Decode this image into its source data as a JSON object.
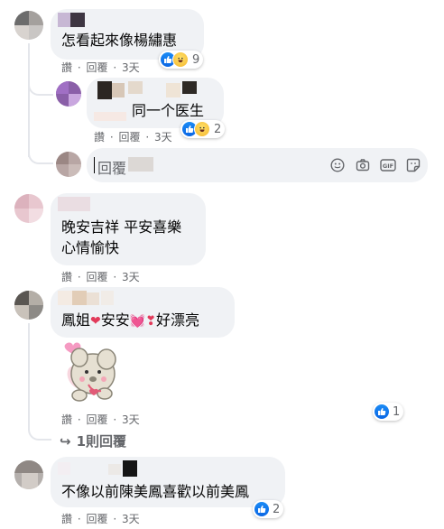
{
  "actions": {
    "like": "讚",
    "reply": "回覆",
    "sep": "·"
  },
  "comments": [
    {
      "text": "怎看起來像楊繡惠",
      "time": "3天",
      "reactions": "9"
    },
    {
      "text": "同一个医生",
      "time": "3天",
      "reactions": "2"
    },
    {
      "line1": "晚安吉祥 平安喜樂",
      "line2": "心情愉快",
      "time": "3天"
    },
    {
      "text_a": "鳳姐",
      "text_b": "安安",
      "text_c": "好漂亮",
      "time": "3天",
      "reactions": "1"
    },
    {
      "text": "不像以前陳美鳳喜歡以前美鳳",
      "time": "3天",
      "reactions": "2"
    }
  ],
  "reply_input": {
    "placeholder": "回覆"
  },
  "more_replies": "1則回覆",
  "icons": {
    "like": "like-icon",
    "haha": "haha-icon",
    "heart": "heart-icon",
    "emoji": "emoji-icon",
    "camera": "camera-icon",
    "gif": "gif-icon",
    "sticker": "sticker-icon",
    "reply_arrow": "reply-arrow-icon"
  },
  "colors": {
    "bubble": "#f0f2f5",
    "meta": "#65676b",
    "like_blue": "#1877f2"
  }
}
